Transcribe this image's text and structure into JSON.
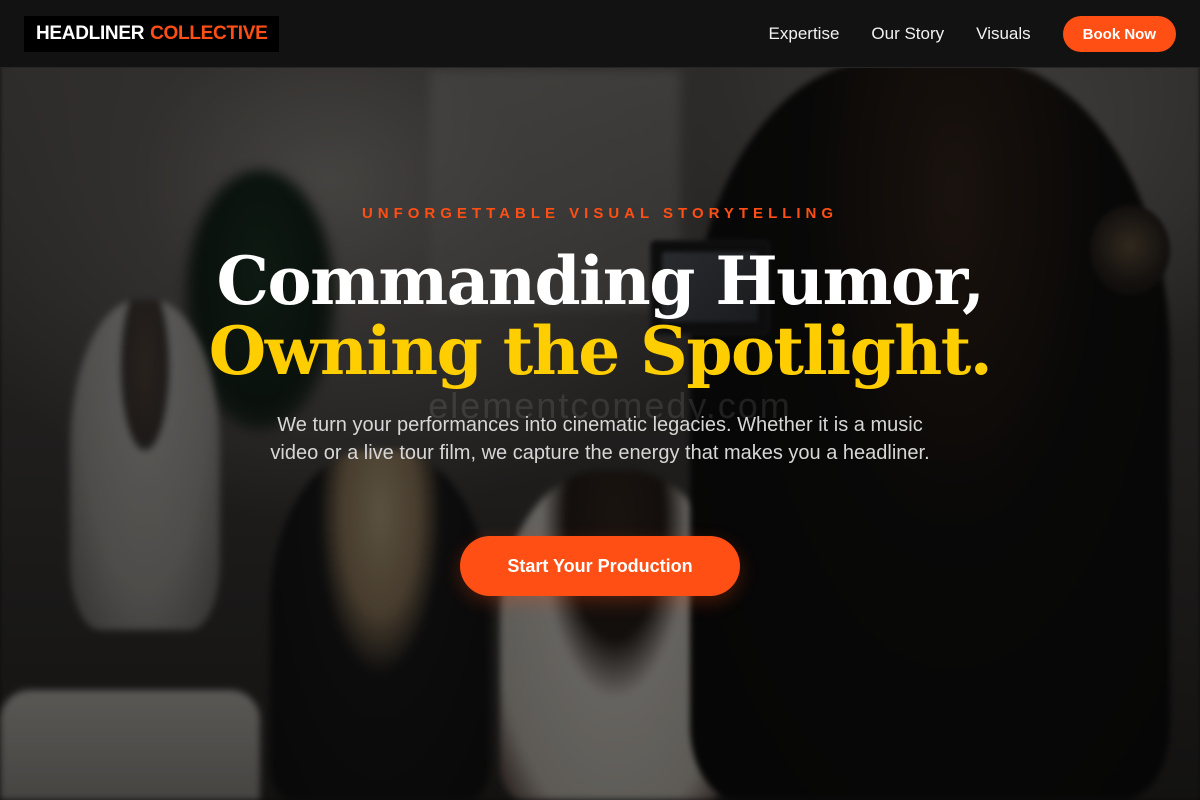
{
  "brand": {
    "name_main": "HEADLINER",
    "name_accent": "COLLECTIVE",
    "accent_color": "#ff4f14",
    "highlight_color": "#ffce00"
  },
  "nav": {
    "links": [
      "Expertise",
      "Our Story",
      "Visuals"
    ],
    "cta_label": "Book Now"
  },
  "hero": {
    "eyebrow": "UNFORGETTABLE VISUAL STORYTELLING",
    "title_line1": "Commanding Humor,",
    "title_line2": "Owning the Spotlight.",
    "watermark": "elementcomedy.com",
    "subtitle": "We turn your performances into cinematic legacies. Whether it is a music video or a live tour film, we capture the energy that makes you a headliner.",
    "cta_label": "Start Your Production"
  }
}
